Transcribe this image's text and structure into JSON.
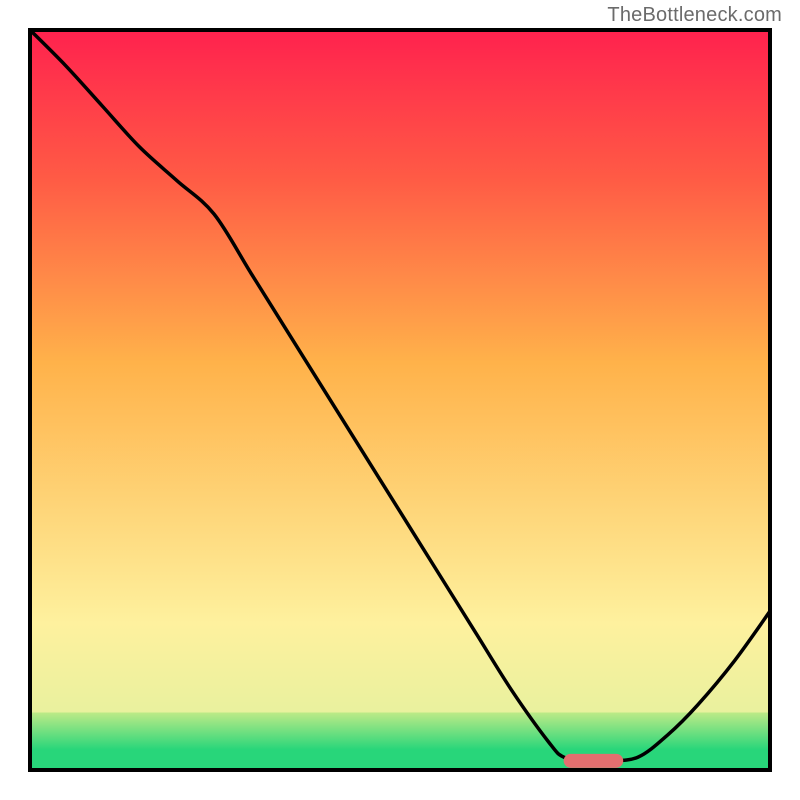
{
  "watermark": "TheBottleneck.com",
  "chart_data": {
    "type": "line",
    "title": "",
    "xlabel": "",
    "ylabel": "",
    "xlim": [
      0,
      100
    ],
    "ylim": [
      0,
      100
    ],
    "grid": false,
    "series": [
      {
        "name": "curve",
        "color": "#000000",
        "x": [
          0,
          5,
          10,
          15,
          20,
          25,
          30,
          35,
          40,
          45,
          50,
          55,
          60,
          65,
          70,
          72,
          75,
          78,
          82,
          86,
          90,
          95,
          100
        ],
        "y": [
          100,
          95,
          89.5,
          84,
          79.5,
          75,
          67,
          59,
          51,
          43,
          35,
          27,
          19,
          11,
          4,
          2,
          1.5,
          1.5,
          2,
          5,
          9,
          15,
          22
        ]
      }
    ],
    "marker": {
      "name": "optimal-range",
      "color": "#e36f6f",
      "x_start": 72,
      "x_end": 80,
      "y": 1.5
    },
    "background_gradient": {
      "bands": [
        {
          "start": 0.0,
          "end": 0.03,
          "from": "#28d67a",
          "to": "#28d67a"
        },
        {
          "start": 0.03,
          "end": 0.08,
          "from": "#28d67a",
          "to": "#bdea87"
        },
        {
          "start": 0.08,
          "end": 0.2,
          "from": "#e9f19e",
          "to": "#fef19e"
        },
        {
          "start": 0.2,
          "end": 0.55,
          "from": "#fef19e",
          "to": "#ffb24a"
        },
        {
          "start": 0.55,
          "end": 0.8,
          "from": "#ffb24a",
          "to": "#ff5a45"
        },
        {
          "start": 0.8,
          "end": 1.0,
          "from": "#ff5a45",
          "to": "#ff214e"
        }
      ]
    }
  }
}
